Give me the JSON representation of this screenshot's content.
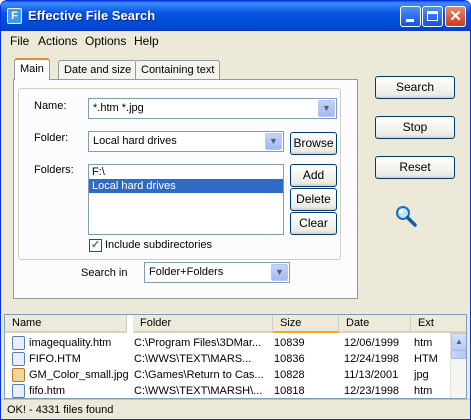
{
  "window": {
    "title": "Effective File Search",
    "app_icon": "app-icon-F",
    "app_icon_letter": "F"
  },
  "menubar": {
    "items": [
      "File",
      "Actions",
      "Options",
      "Help"
    ]
  },
  "tabs": [
    {
      "label": "Main",
      "active": true
    },
    {
      "label": "Date and size",
      "active": false
    },
    {
      "label": "Containing text",
      "active": false
    }
  ],
  "main": {
    "name_label": "Name:",
    "name_value": "*.htm *.jpg",
    "folder_label": "Folder:",
    "folder_value": "Local hard drives",
    "browse_label": "Browse",
    "folders_label": "Folders:",
    "folders_list": [
      "F:\\",
      "Local hard drives"
    ],
    "folders_selected_index": 1,
    "add_label": "Add",
    "delete_label": "Delete",
    "clear_label": "Clear",
    "include_subdirs_label": "Include subdirectories",
    "include_subdirs_checked": true,
    "search_in_label": "Search in",
    "search_in_value": "Folder+Folders"
  },
  "side_buttons": {
    "search": "Search",
    "stop": "Stop",
    "reset": "Reset"
  },
  "results": {
    "columns": [
      "Name",
      "Folder",
      "Size",
      "Date",
      "Ext"
    ],
    "sorted_column": "Size",
    "rows": [
      {
        "name": "imagequality.htm",
        "folder": "C:\\Program Files\\3DMar...",
        "size": "10839",
        "date": "12/06/1999",
        "ext": "htm",
        "icon": "html-file-icon"
      },
      {
        "name": "FIFO.HTM",
        "folder": "C:\\WWS\\TEXT\\MARS...",
        "size": "10836",
        "date": "12/24/1998",
        "ext": "HTM",
        "icon": "html-file-icon"
      },
      {
        "name": "GM_Color_small.jpg",
        "folder": "C:\\Games\\Return to Cas...",
        "size": "10828",
        "date": "11/13/2001",
        "ext": "jpg",
        "icon": "image-file-icon"
      },
      {
        "name": "fifo.htm",
        "folder": "C:\\WWS\\TEXT\\MARSH\\...",
        "size": "10818",
        "date": "12/23/1998",
        "ext": "htm",
        "icon": "html-file-icon"
      }
    ]
  },
  "status": {
    "text": "OK! - 4331 files found"
  },
  "colors": {
    "title_bar": "#0148d6",
    "selection": "#316ac5",
    "window_bg": "#ece9d8",
    "sorted_accent": "#f9a51d"
  }
}
